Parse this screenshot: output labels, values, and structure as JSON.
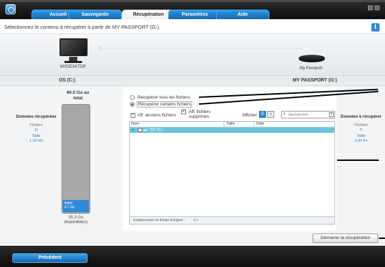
{
  "tabs": [
    {
      "label": "Accueil",
      "active": false
    },
    {
      "label": "Sauvegarde",
      "active": false
    },
    {
      "label": "Récupération",
      "active": true
    },
    {
      "label": "Paramètres",
      "active": false
    },
    {
      "label": "Aide",
      "active": false
    }
  ],
  "instruction": "Sélectionnez le contenu à récupérer à partir de MY PASSPORT (G:).",
  "info_icon": "i",
  "devices": {
    "source_label": "MYDESKTOP",
    "target_label": "My Passport"
  },
  "volumes": {
    "left": "OS (C:)",
    "right": "MY PASSPORT (G:)"
  },
  "left_stats": {
    "title": "Données récupérées",
    "files_label": "Fichiers",
    "files_value": "11",
    "size_label": "Taille",
    "size_value": "1.35 Mo"
  },
  "capacity": {
    "title": "60.0 Go au total",
    "other_label": "Autre",
    "other_value": "4.7 Go",
    "available": "55.3 Go disponible(s)",
    "used_fraction": 0.078
  },
  "options": {
    "all_files": "Récupérer tous les fichiers",
    "some_files": "Récupérer certains fichiers",
    "selected": "some_files"
  },
  "toolbar": {
    "old_files_label": "Aff. anciens fichiers",
    "deleted_files_label": "Aff. fichiers supprimés",
    "view_label": "Afficher",
    "search_placeholder": "Rechercher"
  },
  "file_table": {
    "columns": [
      "Nom",
      "Taille",
      "Date"
    ],
    "rows": [
      {
        "name": "OS (C:)"
      }
    ]
  },
  "path_label": "Emplacement du fichier d'origine :",
  "path_value": "C:\\",
  "right_stats": {
    "title": "Données à récupérer",
    "files_label": "Fichiers",
    "files_value": "0",
    "size_label": "Taille",
    "size_value": "0.00 Ko"
  },
  "start_button": "Démarrer la récupération",
  "prev_button": "Précédent",
  "colors": {
    "accent": "#2e86d6",
    "topbar": "#1a1a1a",
    "row_highlight": "#6cc4dc"
  }
}
